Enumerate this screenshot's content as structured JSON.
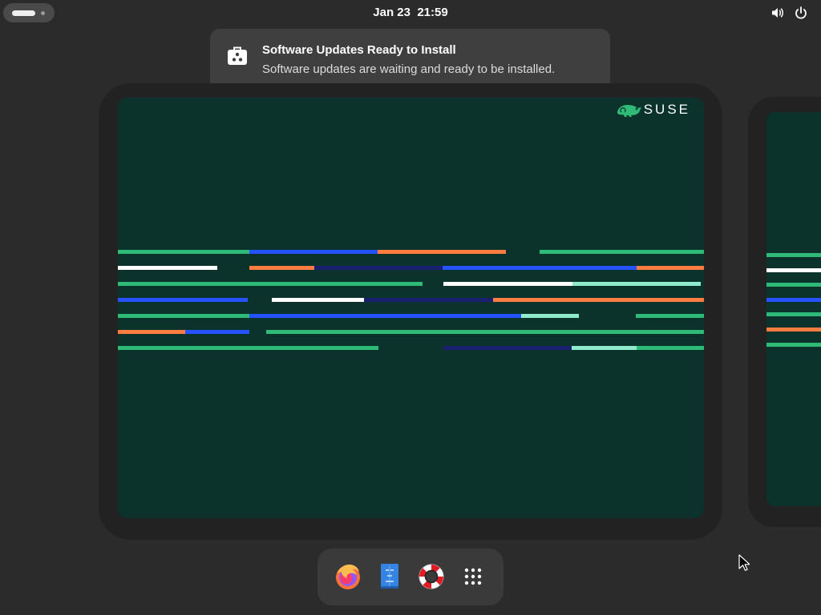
{
  "topbar": {
    "date": "Jan 23",
    "time": "21:59",
    "icons": [
      "workspace-indicator",
      "volume-icon",
      "power-icon"
    ]
  },
  "notification": {
    "icon": "software-store-icon",
    "title": "Software Updates Ready to Install",
    "body": "Software updates are waiting and ready to be installed."
  },
  "workspace": {
    "logo_text": "SUSE",
    "logo_icon": "chameleon-icon",
    "background_color": "#0c322c",
    "stripe_colors": [
      "#30ba78",
      "#2453ff",
      "#fe7c3f",
      "#ffffff",
      "#192072",
      "#90ebcd"
    ]
  },
  "dash": {
    "items": [
      "firefox-icon",
      "text-editor-icon",
      "help-icon",
      "show-apps-icon"
    ]
  }
}
